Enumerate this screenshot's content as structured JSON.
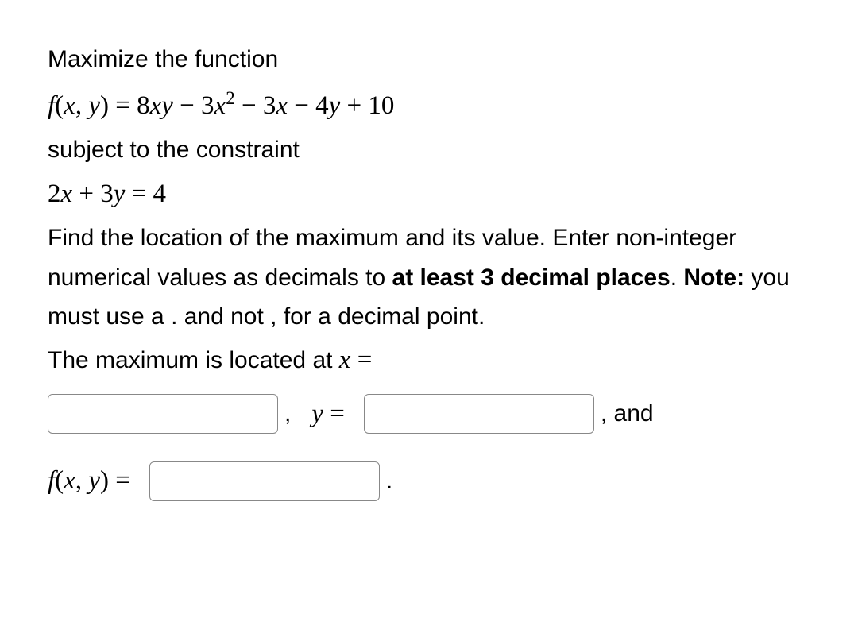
{
  "problem": {
    "intro": "Maximize the function",
    "function": "f(x, y) = 8xy − 3x² − 3x − 4y + 10",
    "subject": "subject to the constraint",
    "constraint": "2x + 3y = 4",
    "instruction_part1": "Find the location of the maximum and its value. Enter non-integer numerical values as decimals to ",
    "instruction_bold1": "at least 3 decimal places",
    "instruction_part2": ". ",
    "instruction_bold2": "Note:",
    "instruction_part3": " you must use a . and not , for a decimal point.",
    "maximum_text": "The maximum is located at ",
    "x_equals": "x =",
    "comma": ",",
    "y_equals": "y =",
    "and_text": ", and",
    "fxy_equals": "f(x, y) =",
    "period": "."
  },
  "inputs": {
    "x_value": "",
    "y_value": "",
    "fxy_value": ""
  }
}
